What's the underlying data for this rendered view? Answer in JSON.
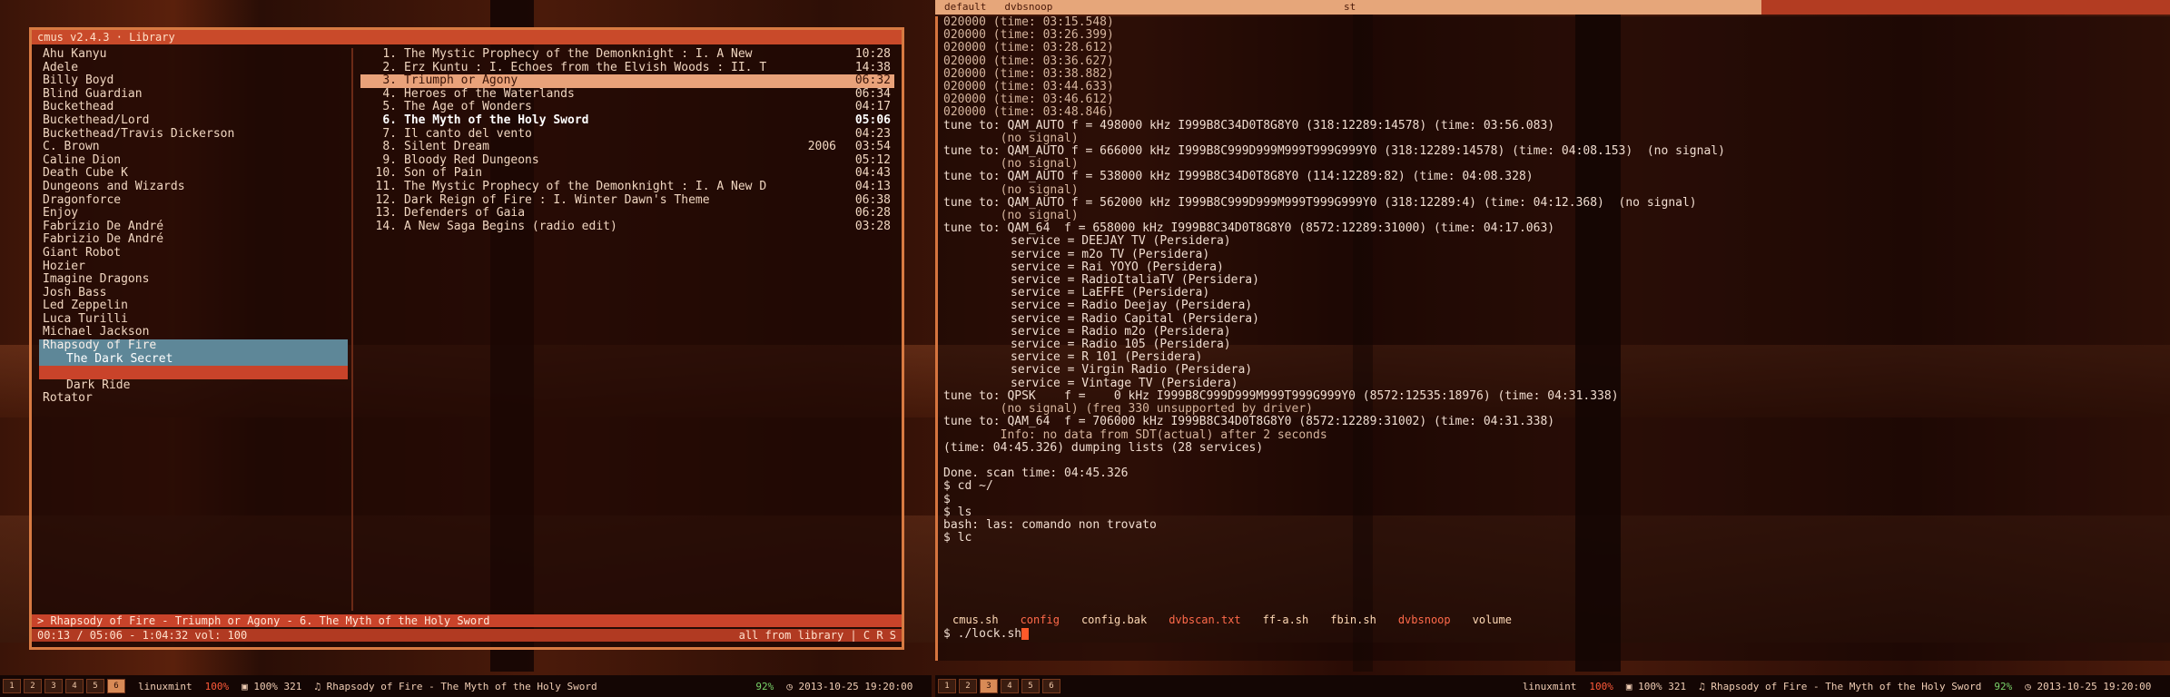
{
  "left_window": {
    "title": "cmus v2.4.3 · Library",
    "artists": [
      {
        "label": "Ahu Kanyu",
        "state": "normal"
      },
      {
        "label": "Adele",
        "state": "normal"
      },
      {
        "label": "Billy Boyd",
        "state": "normal"
      },
      {
        "label": "Blind Guardian",
        "state": "normal"
      },
      {
        "label": "Buckethead",
        "state": "normal"
      },
      {
        "label": "Buckethead/Lord",
        "state": "normal"
      },
      {
        "label": "Buckethead/Travis Dickerson",
        "state": "normal"
      },
      {
        "label": "C. Brown",
        "state": "normal"
      },
      {
        "label": "Caline Dion",
        "state": "normal"
      },
      {
        "label": "Death Cube K",
        "state": "normal"
      },
      {
        "label": "Dungeons and Wizards",
        "state": "normal"
      },
      {
        "label": "Dragonforce",
        "state": "normal"
      },
      {
        "label": "Enjoy",
        "state": "normal"
      },
      {
        "label": "Fabrizio De André",
        "state": "normal"
      },
      {
        "label": "Fabrizio De André",
        "state": "normal"
      },
      {
        "label": "Giant Robot",
        "state": "normal"
      },
      {
        "label": "Hozier",
        "state": "normal"
      },
      {
        "label": "Imagine Dragons",
        "state": "normal"
      },
      {
        "label": "Josh Bass",
        "state": "normal"
      },
      {
        "label": "Led Zeppelin",
        "state": "normal"
      },
      {
        "label": "Luca Turilli",
        "state": "normal"
      },
      {
        "label": "Michael Jackson",
        "state": "normal"
      },
      {
        "label": "Rhapsody of Fire",
        "state": "selected"
      },
      {
        "label": "The Dark Secret",
        "state": "album"
      },
      {
        "label": "",
        "state": "current"
      },
      {
        "label": "Dark Ride",
        "state": "sub"
      },
      {
        "label": "Rotator",
        "state": "normal"
      }
    ],
    "tracks": [
      {
        "n": "1.",
        "title": "The Mystic Prophecy of the Demonknight : I. A New",
        "year": "",
        "dur": "10:28",
        "state": "normal"
      },
      {
        "n": "2.",
        "title": "Erz Kuntu : I. Echoes from the Elvish Woods : II. T",
        "year": "",
        "dur": "14:38",
        "state": "normal"
      },
      {
        "n": "3.",
        "title": "Triumph or Agony",
        "year": "",
        "dur": "06:32",
        "state": "sel"
      },
      {
        "n": "4.",
        "title": "Heroes of the Waterlands",
        "year": "",
        "dur": "06:34",
        "state": "normal"
      },
      {
        "n": "5.",
        "title": "The Age of Wonders",
        "year": "",
        "dur": "04:17",
        "state": "normal"
      },
      {
        "n": "6.",
        "title": "The Myth of the Holy Sword",
        "year": "",
        "dur": "05:06",
        "state": "playing"
      },
      {
        "n": "7.",
        "title": "Il canto del vento",
        "year": "",
        "dur": "04:23",
        "state": "normal"
      },
      {
        "n": "8.",
        "title": "Silent Dream",
        "year": "2006",
        "dur": "03:54",
        "state": "normal"
      },
      {
        "n": "9.",
        "title": "Bloody Red Dungeons",
        "year": "",
        "dur": "05:12",
        "state": "normal"
      },
      {
        "n": "10.",
        "title": "Son of Pain",
        "year": "",
        "dur": "04:43",
        "state": "normal"
      },
      {
        "n": "11.",
        "title": "The Mystic Prophecy of the Demonknight : I. A New D",
        "year": "",
        "dur": "04:13",
        "state": "normal"
      },
      {
        "n": "12.",
        "title": "Dark Reign of Fire : I. Winter Dawn's Theme",
        "year": "",
        "dur": "06:38",
        "state": "normal"
      },
      {
        "n": "13.",
        "title": "Defenders of Gaia",
        "year": "",
        "dur": "06:28",
        "state": "normal"
      },
      {
        "n": "14.",
        "title": "A New Saga Begins (radio edit)",
        "year": "",
        "dur": "03:28",
        "state": "normal"
      }
    ],
    "status_top": [
      "> Rhapsody of Fire - Triumph or Agony - 6. The Myth of the Holy Sword"
    ],
    "status_bottom_left": "00:13 / 05:06 - 1:04:32 vol: 100",
    "status_bottom_right": "all from library | C R S"
  },
  "right_window": {
    "tabs": [
      "default",
      "dvbsnoop"
    ],
    "window_title": "st"
  },
  "terminal": {
    "lines": [
      {
        "text": "020000 (time: 03:15.548)",
        "kind": "dim"
      },
      {
        "text": "020000 (time: 03:26.399)",
        "kind": "dim"
      },
      {
        "text": "020000 (time: 03:28.612)",
        "kind": "dim"
      },
      {
        "text": "020000 (time: 03:36.627)",
        "kind": "dim"
      },
      {
        "text": "020000 (time: 03:38.882)",
        "kind": "dim"
      },
      {
        "text": "020000 (time: 03:44.633)",
        "kind": "dim"
      },
      {
        "text": "020000 (time: 03:46.612)",
        "kind": "dim"
      },
      {
        "text": "020000 (time: 03:48.846)",
        "kind": "dim"
      },
      {
        "text": "tune to: QAM_AUTO f = 498000 kHz I999B8C34D0T8G8Y0 (318:12289:14578) (time: 03:56.083)",
        "kind": "normal"
      },
      {
        "text": "        (no signal)",
        "kind": "dim"
      },
      {
        "text": "tune to: QAM_AUTO f = 666000 kHz I999B8C999D999M999T999G999Y0 (318:12289:14578) (time: 04:08.153)  (no signal)",
        "kind": "normal"
      },
      {
        "text": "        (no signal)",
        "kind": "dim"
      },
      {
        "text": "tune to: QAM_AUTO f = 538000 kHz I999B8C34D0T8G8Y0 (114:12289:82) (time: 04:08.328)",
        "kind": "normal"
      },
      {
        "text": "        (no signal)",
        "kind": "dim"
      },
      {
        "text": "tune to: QAM_AUTO f = 562000 kHz I999B8C999D999M999T999G999Y0 (318:12289:4) (time: 04:12.368)  (no signal)",
        "kind": "normal"
      },
      {
        "text": "        (no signal)",
        "kind": "dim"
      },
      {
        "text": "tune to: QAM_64  f = 658000 kHz I999B8C34D0T8G8Y0 (8572:12289:31000) (time: 04:17.063)",
        "kind": "normal"
      },
      {
        "text": "service = DEEJAY TV (Persidera)",
        "kind": "svc"
      },
      {
        "text": "service = m2o TV (Persidera)",
        "kind": "svc"
      },
      {
        "text": "service = Rai YOYO (Persidera)",
        "kind": "svc"
      },
      {
        "text": "service = RadioItaliaTV (Persidera)",
        "kind": "svc"
      },
      {
        "text": "service = LaEFFE (Persidera)",
        "kind": "svc"
      },
      {
        "text": "service = Radio Deejay (Persidera)",
        "kind": "svc"
      },
      {
        "text": "service = Radio Capital (Persidera)",
        "kind": "svc"
      },
      {
        "text": "service = Radio m2o (Persidera)",
        "kind": "svc"
      },
      {
        "text": "service = Radio 105 (Persidera)",
        "kind": "svc"
      },
      {
        "text": "service = R 101 (Persidera)",
        "kind": "svc"
      },
      {
        "text": "service = Virgin Radio (Persidera)",
        "kind": "svc"
      },
      {
        "text": "service = Vintage TV (Persidera)",
        "kind": "svc"
      },
      {
        "text": "tune to: QPSK    f =    0 kHz I999B8C999D999M999T999G999Y0 (8572:12535:18976) (time: 04:31.338)",
        "kind": "normal"
      },
      {
        "text": "        (no signal) (freq 330 unsupported by driver)",
        "kind": "dim"
      },
      {
        "text": "tune to: QAM_64  f = 706000 kHz I999B8C34D0T8G8Y0 (8572:12289:31002) (time: 04:31.338)",
        "kind": "normal"
      },
      {
        "text": "        Info: no data from SDT(actual) after 2 seconds",
        "kind": "dim"
      },
      {
        "text": "(time: 04:45.326) dumping lists (28 services)",
        "kind": "normal"
      },
      {
        "text": "",
        "kind": "normal"
      },
      {
        "text": "Done. scan time: 04:45.326",
        "kind": "normal"
      },
      {
        "text": "$ cd ~/",
        "kind": "normal"
      },
      {
        "text": "$",
        "kind": "normal"
      },
      {
        "text": "$ ls",
        "kind": "normal"
      },
      {
        "text": "bash: las: comando non trovato",
        "kind": "normal"
      },
      {
        "text": "$ lc",
        "kind": "normal"
      }
    ],
    "cmdbar": [
      {
        "label": "cmus.sh",
        "kind": "on"
      },
      {
        "label": "config",
        "kind": "red"
      },
      {
        "label": "config.bak",
        "kind": "on"
      },
      {
        "label": "dvbscan.txt",
        "kind": "red"
      },
      {
        "label": "ff-a.sh",
        "kind": "on"
      },
      {
        "label": "fbin.sh",
        "kind": "on"
      },
      {
        "label": "dvbsnoop",
        "kind": "red"
      },
      {
        "label": "volume",
        "kind": "on"
      }
    ],
    "prompt": "$ ./lock.sh"
  },
  "taskbar_left": {
    "workspaces": [
      "1",
      "2",
      "3",
      "4",
      "5",
      "6"
    ],
    "active_ws": 5,
    "items": [
      {
        "label": "linuxmint",
        "kind": "normal"
      },
      {
        "label": "100%",
        "kind": "red"
      },
      {
        "label": "▣ 100% 321",
        "kind": "normal"
      },
      {
        "label": "♫ Rhapsody of Fire - The Myth of the Holy Sword",
        "kind": "normal"
      }
    ],
    "right_items": [
      {
        "label": "92%",
        "kind": "green"
      },
      {
        "label": "◷ 2013-10-25 19:20:00",
        "kind": "normal"
      }
    ]
  },
  "taskbar_right": {
    "workspaces": [
      "1",
      "2",
      "3",
      "4",
      "5",
      "6"
    ],
    "active_ws": 2,
    "items": [],
    "right_items": [
      {
        "label": "linuxmint",
        "kind": "normal"
      },
      {
        "label": "100%",
        "kind": "red"
      },
      {
        "label": "▣ 100% 321",
        "kind": "normal"
      },
      {
        "label": "♫ Rhapsody of Fire - The Myth of the Holy Sword",
        "kind": "normal"
      },
      {
        "label": "92%",
        "kind": "green"
      },
      {
        "label": "◷ 2013-10-25 19:20:00",
        "kind": "normal"
      }
    ]
  }
}
